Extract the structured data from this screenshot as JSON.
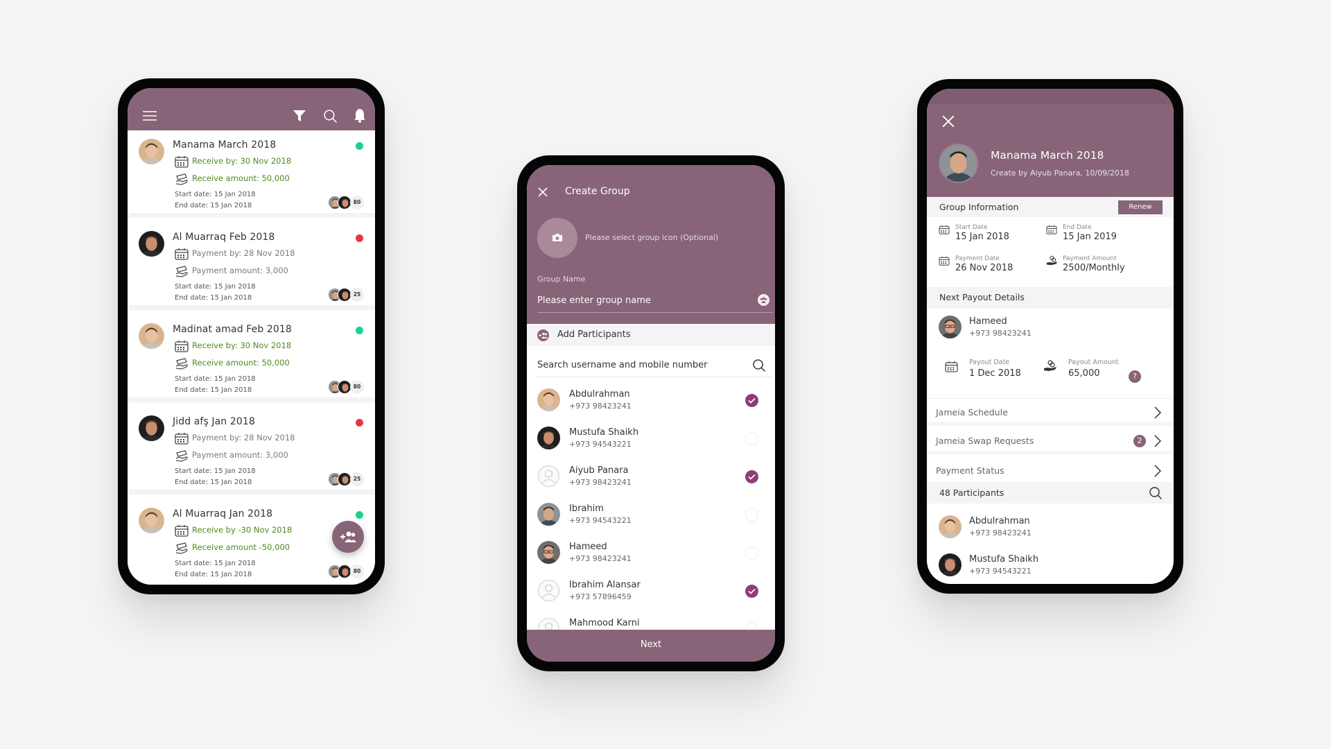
{
  "theme": {
    "primary": "#876477",
    "check": "#8e3e77",
    "green_status": "#1ed18a",
    "red_status": "#ee3340",
    "receive_text": "#4f8a1f"
  },
  "groups_list": {
    "header_icons": [
      "menu-icon",
      "filter-icon",
      "search-icon",
      "bell-icon"
    ],
    "cards": [
      {
        "title": "Manama March 2018",
        "type": "receive",
        "line1": "Receive by: 30 Nov 2018",
        "line2": "Receive amount: 50,000",
        "start": "Start date: 15 Jan 2018",
        "end": "End date: 15 Jan 2018",
        "status": "green",
        "participants": "80"
      },
      {
        "title": "Al Muarraq Feb 2018",
        "type": "payment",
        "line1": "Payment by: 28 Nov 2018",
        "line2": "Payment amount: 3,000",
        "start": "Start date: 15 Jan 2018",
        "end": "End date: 15 Jan 2018",
        "status": "red",
        "participants": "25"
      },
      {
        "title": "Madinat amad Feb 2018",
        "type": "receive",
        "line1": "Receive by: 30 Nov 2018",
        "line2": "Receive amount: 50,000",
        "start": "Start date: 15 Jan 2018",
        "end": "End date: 15 Jan 2018",
        "status": "green",
        "participants": "80"
      },
      {
        "title": "Jidd afş Jan 2018",
        "type": "payment",
        "line1": "Payment by: 28 Nov 2018",
        "line2": "Payment amount: 3,000",
        "start": "Start date: 15 Jan 2018",
        "end": "End date: 15 Jan 2018",
        "status": "red",
        "participants": "25"
      },
      {
        "title": "Al Muarraq Jan 2018",
        "type": "receive",
        "line1": "Receive by -30 Nov 2018",
        "line2": "Receive amount -50,000",
        "start": "Start date: 15 Jan 2018",
        "end": "End date: 15 Jan 2018",
        "status": "green",
        "participants": "80"
      }
    ],
    "fab_icon": "add-group-icon"
  },
  "create_group": {
    "title": "Create Group",
    "icon_prompt": "Please select group icon (Optional)",
    "group_name_label": "Group Name",
    "group_name_placeholder": "Please enter group name",
    "add_participants_label": "Add Participants",
    "search_placeholder": "Search username and mobile number",
    "participants": [
      {
        "name": "Abdulrahman",
        "phone": "+973 98423241",
        "selected": true
      },
      {
        "name": "Mustufa Shaikh",
        "phone": "+973 94543221",
        "selected": false
      },
      {
        "name": "Aiyub Panara",
        "phone": "+973 98423241",
        "selected": true
      },
      {
        "name": "Ibrahim",
        "phone": "+973 94543221",
        "selected": false
      },
      {
        "name": "Hameed",
        "phone": "+973 98423241",
        "selected": false
      },
      {
        "name": "Ibrahim Alansar",
        "phone": "+973 57896459",
        "selected": true
      },
      {
        "name": "Mahmood Karni",
        "phone": "",
        "selected": false
      }
    ],
    "next_label": "Next"
  },
  "group_details": {
    "title": "Manama March 2018",
    "subtitle": "Create by Aiyub Panara, 10/09/2018",
    "group_info_label": "Group Information",
    "renew_label": "Renew",
    "info": [
      {
        "label": "Start Date",
        "value": "15 Jan 2018",
        "icon": "calendar-icon"
      },
      {
        "label": "End Date",
        "value": "15 Jan 2019",
        "icon": "calendar-icon"
      },
      {
        "label": "Payment Date",
        "value": "26 Nov 2018",
        "icon": "calendar-icon"
      },
      {
        "label": "Payment Amount",
        "value": "2500/Monthly",
        "icon": "money-hand-icon"
      }
    ],
    "next_payout_label": "Next Payout Details",
    "payout_person": {
      "name": "Hameed",
      "phone": "+973 98423241"
    },
    "payout_date_label": "Payout Date",
    "payout_date": "1 Dec 2018",
    "payout_amount_label": "Payout Amount",
    "payout_amount": "65,000",
    "help_label": "?",
    "nav": [
      {
        "label": "Jameia Schedule",
        "badge": ""
      },
      {
        "label": "Jameia Swap Requests",
        "badge": "2"
      },
      {
        "label": "Payment Status",
        "badge": ""
      }
    ],
    "participants_label": "48 Participants",
    "participants": [
      {
        "name": "Abdulrahman",
        "phone": "+973 98423241"
      },
      {
        "name": "Mustufa Shaikh",
        "phone": "+973 94543221"
      }
    ]
  }
}
